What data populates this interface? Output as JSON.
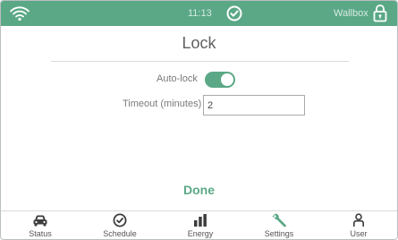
{
  "topbar": {
    "time": "11:13",
    "device_name": "Wallbox",
    "icons": [
      "wifi-icon",
      "check-circle-icon",
      "padlock-icon"
    ]
  },
  "page": {
    "title": "Lock"
  },
  "form": {
    "autolock_label": "Auto-lock",
    "autolock_enabled": true,
    "timeout_label": "Timeout (minutes)",
    "timeout_value": "2"
  },
  "actions": {
    "done_label": "Done"
  },
  "nav": {
    "items": [
      {
        "label": "Status",
        "icon": "car-icon"
      },
      {
        "label": "Schedule",
        "icon": "clock-icon"
      },
      {
        "label": "Energy",
        "icon": "bar-chart-icon"
      },
      {
        "label": "Settings",
        "icon": "wrench-icon",
        "active": true
      },
      {
        "label": "User",
        "icon": "user-icon"
      }
    ]
  },
  "colors": {
    "accent": "#5ba886",
    "topbar_text": "#d6ebe1",
    "title_text": "#5f6062",
    "label_text": "#7a7a7a"
  }
}
